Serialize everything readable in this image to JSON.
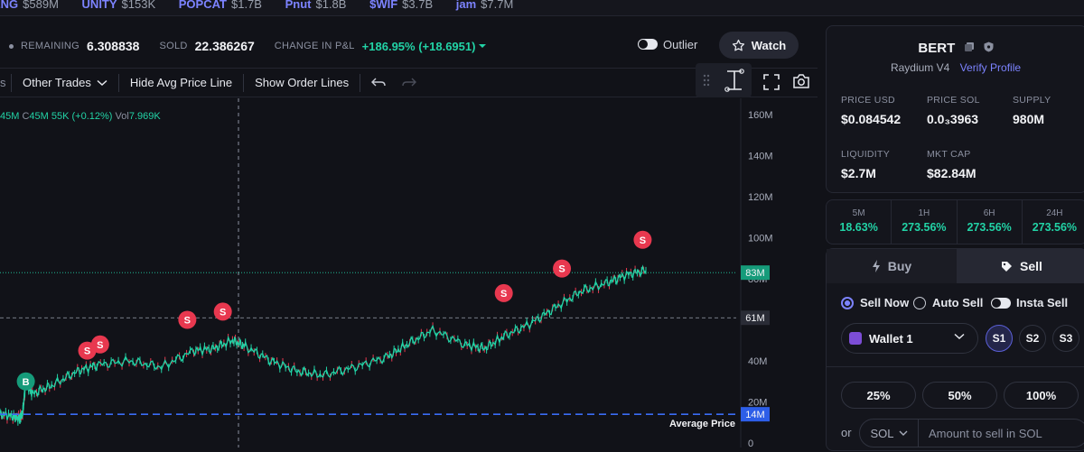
{
  "ticker": [
    {
      "sym": "ENG",
      "val": "$589M"
    },
    {
      "sym": "UNITY",
      "val": "$153K"
    },
    {
      "sym": "POPCAT",
      "val": "$1.7B"
    },
    {
      "sym": "Pnut",
      "val": "$1.8B"
    },
    {
      "sym": "$WIF",
      "val": "$3.7B"
    },
    {
      "sym": "jam",
      "val": "$7.7M"
    }
  ],
  "info": {
    "remaining_label": "REMAINING",
    "remaining_value": "6.308838",
    "sold_label": "SOLD",
    "sold_value": "22.386267",
    "pnl_label": "CHANGE IN P&L",
    "pnl_value": "+186.95% (+18.6951)",
    "outlier_label": "Outlier",
    "watch_label": "Watch"
  },
  "toolbar": {
    "first": "s",
    "other_trades": "Other Trades",
    "hide_avg": "Hide Avg Price Line",
    "show_order": "Show Order Lines"
  },
  "legend": {
    "h": "45M",
    "c_label": "C",
    "c_value": "45M",
    "change": "55K (+0.12%)",
    "vol_label": "Vol",
    "vol_value": "7.969K"
  },
  "chart_data": {
    "type": "line",
    "ylim": [
      0,
      160
    ],
    "ytick_labels": [
      "160M",
      "140M",
      "120M",
      "100M",
      "80M",
      "60M",
      "40M",
      "20M",
      "0"
    ],
    "yticks": [
      160,
      140,
      120,
      100,
      80,
      60,
      40,
      20,
      0
    ],
    "series": [
      {
        "x": [
          0,
          0.02,
          0.03,
          0.035,
          0.04,
          0.05,
          0.08,
          0.12,
          0.15,
          0.2,
          0.25,
          0.3,
          0.33,
          0.36,
          0.38,
          0.42,
          0.46,
          0.5,
          0.55,
          0.6,
          0.63,
          0.67,
          0.72,
          0.75,
          0.78,
          0.82,
          0.86,
          0.9,
          0.94,
          0.97,
          1.0
        ],
        "values": [
          14,
          13,
          12,
          14,
          30,
          24,
          28,
          35,
          38,
          40,
          37,
          45,
          46,
          50,
          47,
          40,
          35,
          33,
          37,
          42,
          48,
          55,
          48,
          46,
          52,
          58,
          66,
          74,
          78,
          82,
          84
        ]
      }
    ],
    "price_labels": [
      {
        "label": "83M",
        "value": 83
      },
      {
        "label": "61M",
        "value": 61
      },
      {
        "label": "14M",
        "value": 14
      }
    ],
    "avg_price_label": "Average Price",
    "markers": [
      {
        "type": "B",
        "x": 0.04,
        "value": 30
      },
      {
        "type": "S",
        "x": 0.135,
        "value": 45
      },
      {
        "type": "S",
        "x": 0.155,
        "value": 48
      },
      {
        "type": "S",
        "x": 0.29,
        "value": 60
      },
      {
        "type": "S",
        "x": 0.345,
        "value": 64
      },
      {
        "type": "S",
        "x": 0.78,
        "value": 73
      },
      {
        "type": "S",
        "x": 0.87,
        "value": 85
      },
      {
        "type": "S",
        "x": 0.995,
        "value": 99
      }
    ]
  },
  "token": {
    "name": "BERT",
    "dex": "Raydium V4",
    "verify": "Verify Profile",
    "stats": [
      {
        "label": "PRICE USD",
        "value": "$0.084542"
      },
      {
        "label": "PRICE SOL",
        "value": "0.0₃3963"
      },
      {
        "label": "SUPPLY",
        "value": "980M"
      },
      {
        "label": "LIQUIDITY",
        "value": "$2.7M"
      },
      {
        "label": "MKT CAP",
        "value": "$82.84M"
      }
    ],
    "changes": [
      {
        "label": "5M",
        "value": "18.63%"
      },
      {
        "label": "1H",
        "value": "273.56%"
      },
      {
        "label": "6H",
        "value": "273.56%"
      },
      {
        "label": "24H",
        "value": "273.56%"
      }
    ]
  },
  "trade": {
    "buy_label": "Buy",
    "sell_label": "Sell",
    "sell_now": "Sell Now",
    "auto_sell": "Auto Sell",
    "insta_sell": "Insta Sell",
    "wallet": "Wallet 1",
    "wallet_badge": "1",
    "slots": [
      "S1",
      "S2",
      "S3"
    ],
    "percents": [
      "25%",
      "50%",
      "100%"
    ],
    "or_label": "or",
    "currency": "SOL",
    "amount_placeholder": "Amount to sell in SOL"
  },
  "colors": {
    "up": "#22d3a6",
    "sell_marker": "#e8384f",
    "buy_marker": "#169b7a",
    "accent": "#7c83ff",
    "avg_line": "#3b6cf5"
  }
}
